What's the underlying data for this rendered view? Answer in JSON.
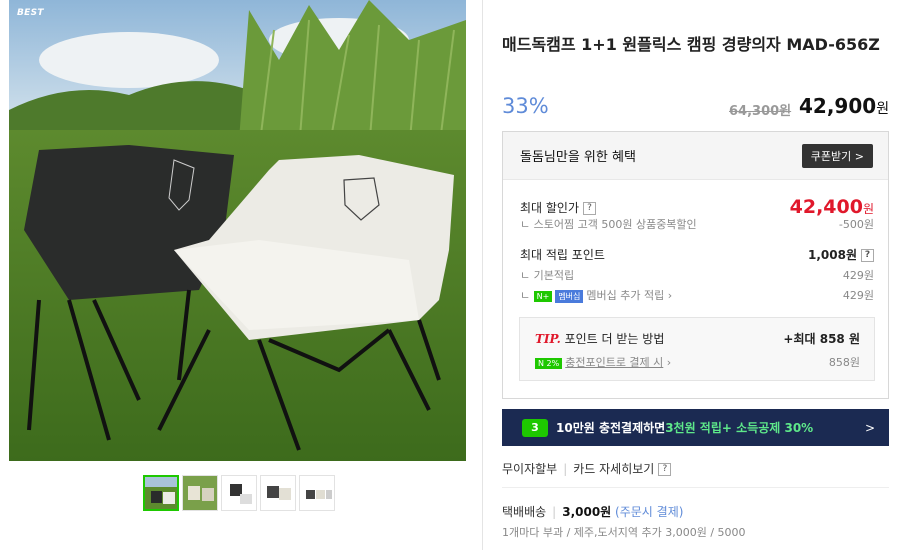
{
  "gallery": {
    "badge": "BEST",
    "thumbnail_count": 5
  },
  "product": {
    "title": "매드독캠프 1+1 원플릭스 캠핑 경량의자 MAD-656Z",
    "discount_rate": "33%",
    "original_price": "64,300원",
    "sale_price": "42,900",
    "sale_unit": "원"
  },
  "benefit": {
    "header": "돌돔님만을 위한 혜택",
    "coupon_button": "쿠폰받기 >",
    "max_discount_label": "최대 할인가",
    "max_discount_price": "42,400",
    "max_discount_unit": "원",
    "store_discount_label": "스토어찜 고객 500원 상품중복할인",
    "store_discount_value": "-500원",
    "points_label": "최대 적립 포인트",
    "points_value": "1,008원",
    "basic_points_label": "기본적립",
    "basic_points_value": "429원",
    "membership_badge_n": "N+",
    "membership_badge": "멤버십",
    "membership_label": "멤버십 추가 적립",
    "membership_value": "429원",
    "tip_prefix": "TIP.",
    "tip_label": "포인트 더 받는 방법",
    "tip_max": "+최대 858 원",
    "tip_badge": "N 2%",
    "tip_sub_label": "충전포인트로 결제 시",
    "tip_sub_value": "858원",
    "help_mark": "?"
  },
  "banner": {
    "badge": "3",
    "text_a": "10만원 충전결제하면 ",
    "text_b": "3천원 적립",
    "text_c": " + 소득공제 30%",
    "arrow": ">"
  },
  "links": {
    "installment": "무이자할부",
    "card_detail": "카드 자세히보기"
  },
  "shipping": {
    "label": "택배배송",
    "fee": "3,000원",
    "payment": "(주문시 결제)",
    "extra": "1개마다 부과 / 제주,도서지역 추가 3,000원 / 5000"
  }
}
